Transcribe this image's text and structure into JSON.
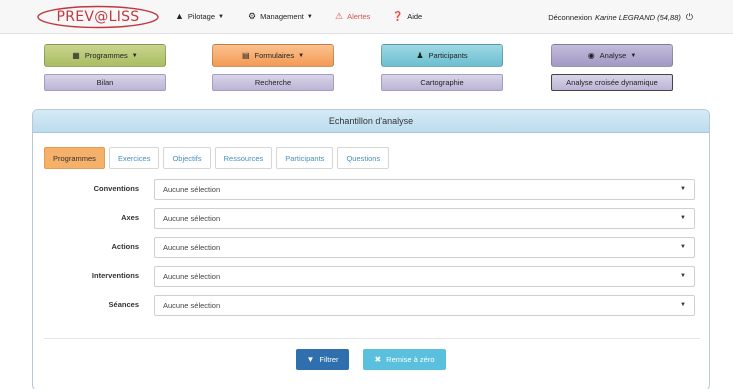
{
  "brand": {
    "logo_text": "PREV@LISS"
  },
  "nav": {
    "pilotage": "Pilotage",
    "management": "Management",
    "alertes": "Alertes",
    "aide": "Aide",
    "logout_label": "Déconnexion",
    "user": "Karine LEGRAND (54,88)"
  },
  "modules": {
    "programmes": "Programmes",
    "formulaires": "Formulaires",
    "participants": "Participants",
    "analyse": "Analyse"
  },
  "subnav": {
    "bilan": "Bilan",
    "recherche": "Recherche",
    "cartographie": "Cartographie",
    "analyse_croisee": "Analyse croisée dynamique"
  },
  "panel": {
    "title": "Echantillon d'analyse",
    "tabs": [
      "Programmes",
      "Exercices",
      "Objectifs",
      "Ressources",
      "Participants",
      "Questions"
    ],
    "active_tab": "Programmes",
    "filters": [
      {
        "label": "Conventions",
        "value": "Aucune sélection"
      },
      {
        "label": "Axes",
        "value": "Aucune sélection"
      },
      {
        "label": "Actions",
        "value": "Aucune sélection"
      },
      {
        "label": "Interventions",
        "value": "Aucune sélection"
      },
      {
        "label": "Séances",
        "value": "Aucune sélection"
      }
    ],
    "filter_button": "Filtrer",
    "reset_button": "Remise à zéro"
  },
  "colors": {
    "programmes": "#b5c574",
    "formulaires": "#f6a765",
    "participants": "#85cbd9",
    "analyse": "#b0a7cf",
    "alert": "#d9534f",
    "tab_active": "#f5b06a",
    "primary": "#2f6fae",
    "info": "#5bc0de"
  },
  "icons": {
    "pilotage": "pilotage-icon",
    "management": "gear-icon",
    "alertes": "warning-icon",
    "aide": "help-icon",
    "logout": "power-icon",
    "programmes": "grid-icon",
    "formulaires": "form-icon",
    "participants": "user-icon",
    "analyse": "eye-icon",
    "filter": "filter-icon",
    "reset": "close-icon"
  }
}
